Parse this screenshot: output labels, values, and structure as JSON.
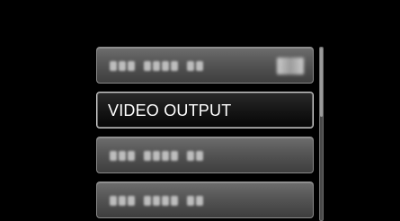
{
  "menu": {
    "items": [
      {
        "label": "",
        "obscured": true,
        "has_value": true
      },
      {
        "label": "VIDEO OUTPUT",
        "obscured": false,
        "selected": true
      },
      {
        "label": "",
        "obscured": true
      },
      {
        "label": "",
        "obscured": true
      }
    ]
  },
  "scrollbar": {
    "position_fraction": 0.0
  },
  "colors": {
    "background": "#000000",
    "item_bg": "#555555",
    "selected_item_bg": "#111111",
    "text": "#ffffff"
  }
}
